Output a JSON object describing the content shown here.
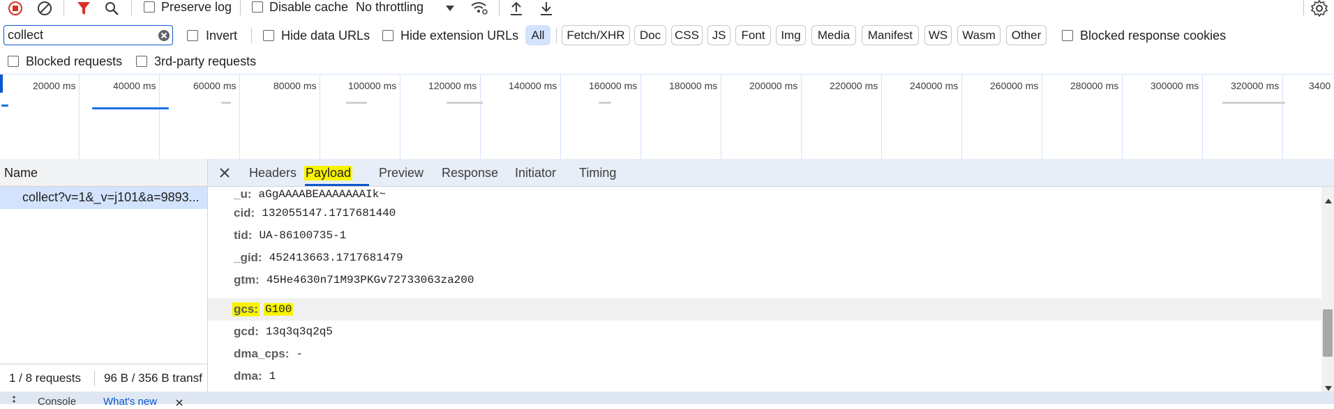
{
  "toolbar": {
    "preserve_log_label": "Preserve log",
    "disable_cache_label": "Disable cache",
    "throttling_value": "No throttling"
  },
  "filter": {
    "input_value": "collect",
    "invert_label": "Invert",
    "hide_data_urls_label": "Hide data URLs",
    "hide_extension_urls_label": "Hide extension URLs",
    "types": [
      "All",
      "Fetch/XHR",
      "Doc",
      "CSS",
      "JS",
      "Font",
      "Img",
      "Media",
      "Manifest",
      "WS",
      "Wasm",
      "Other"
    ],
    "active_type": "All",
    "blocked_response_cookies_label": "Blocked response cookies",
    "blocked_requests_label": "Blocked requests",
    "third_party_label": "3rd-party requests"
  },
  "timeline": {
    "ticks": [
      "20000 ms",
      "40000 ms",
      "60000 ms",
      "80000 ms",
      "100000 ms",
      "120000 ms",
      "140000 ms",
      "160000 ms",
      "180000 ms",
      "200000 ms",
      "220000 ms",
      "240000 ms",
      "260000 ms",
      "280000 ms",
      "300000 ms",
      "320000 ms",
      "3400"
    ]
  },
  "request_list": {
    "column_name": "Name",
    "selected_request": "collect?v=1&_v=j101&a=9893...",
    "status_requests": "1 / 8 requests",
    "status_transfer": "96 B / 356 B transf"
  },
  "detail": {
    "tabs": [
      "Headers",
      "Payload",
      "Preview",
      "Response",
      "Initiator",
      "Timing"
    ],
    "active_tab": "Payload",
    "params": [
      {
        "key": "_u:",
        "value": "aGgAAAABEAAAAAAAIk~"
      },
      {
        "key": "cid:",
        "value": "132055147.1717681440"
      },
      {
        "key": "tid:",
        "value": "UA-86100735-1"
      },
      {
        "key": "_gid:",
        "value": "452413663.1717681479"
      },
      {
        "key": "gtm:",
        "value": "45He4630n71M93PKGv72733063za200"
      },
      {
        "key": "gcs:",
        "value": "G100"
      },
      {
        "key": "gcd:",
        "value": "13q3q3q2q5"
      },
      {
        "key": "dma_cps:",
        "value": "-"
      },
      {
        "key": "dma:",
        "value": "1"
      }
    ],
    "highlighted_param": "gcs:"
  },
  "drawer": {
    "tabs": [
      "Console",
      "What's new"
    ]
  },
  "colors": {
    "accent": "#0b57d0",
    "highlight": "#f8f400",
    "record_red": "#d93025"
  }
}
